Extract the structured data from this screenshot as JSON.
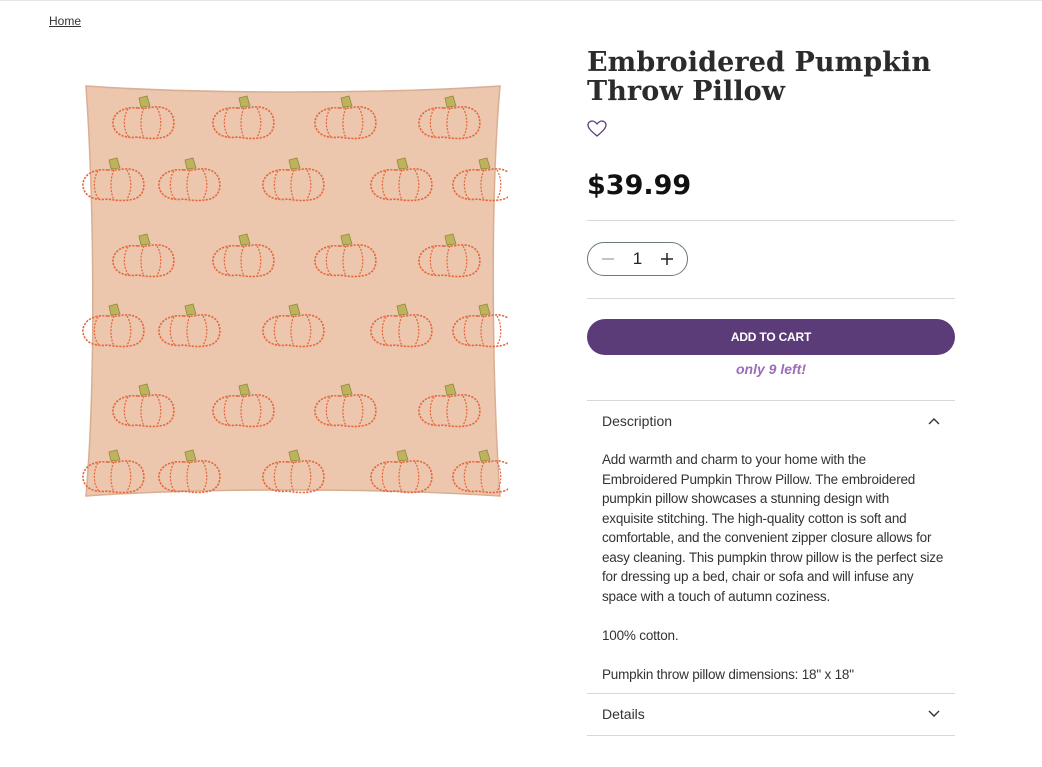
{
  "breadcrumb": {
    "home": "Home"
  },
  "product": {
    "title_line1": "Embroidered Pumpkin",
    "title_line2": "Throw Pillow",
    "price": "$39.99",
    "quantity": "1",
    "add_to_cart": "ADD TO CART",
    "stock_note": "only 9 left!",
    "colors": {
      "accent": "#5b3c78",
      "stock": "#9b6cba",
      "pillow": "#ecc6ad",
      "pumpkin": "#e8663a",
      "stem": "#b4ad54"
    }
  },
  "accordion": {
    "description_label": "Description",
    "description_paragraphs": [
      "Add warmth and charm to your home with the Embroidered Pumpkin Throw Pillow. The embroidered pumpkin pillow showcases a stunning design with exquisite stitching. The high-quality cotton is soft and comfortable, and the convenient zipper closure allows for easy cleaning. This pumpkin throw pillow is the perfect size for dressing up a bed, chair or sofa and will infuse any space with a touch of autumn coziness.",
      "100% cotton.",
      "Pumpkin throw pillow dimensions: 18\" x 18\""
    ],
    "details_label": "Details"
  },
  "icons": [
    "heart-icon",
    "minus-icon",
    "plus-icon",
    "chevron-up-icon",
    "chevron-down-icon"
  ]
}
